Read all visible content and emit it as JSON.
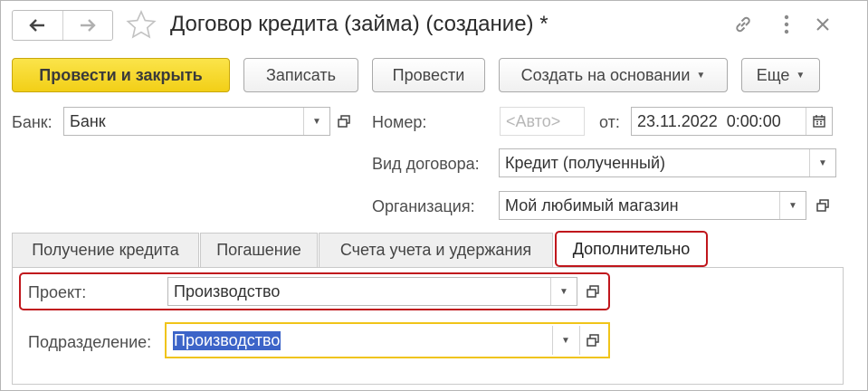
{
  "window": {
    "title": "Договор кредита (займа) (создание) *",
    "icons": [
      "arrow-left-icon",
      "arrow-right-icon",
      "star-icon",
      "link-icon",
      "more-vertical-icon",
      "close-icon"
    ]
  },
  "toolbar": {
    "post_and_close": "Провести и закрыть",
    "save": "Записать",
    "post": "Провести",
    "create_based_on": "Создать на основании",
    "more": "Еще"
  },
  "header_fields": {
    "bank_label": "Банк:",
    "bank_value": "Банк",
    "number_label": "Номер:",
    "number_placeholder": "<Авто>",
    "date_label": "от:",
    "date_value": "23.11.2022  0:00:00",
    "contract_type_label": "Вид договора:",
    "contract_type_value": "Кредит (полученный)",
    "organization_label": "Организация:",
    "organization_value": "Мой любимый магазин"
  },
  "tabs": [
    {
      "label": "Получение кредита",
      "active": false
    },
    {
      "label": "Погашение",
      "active": false
    },
    {
      "label": "Счета учета и удержания",
      "active": false
    },
    {
      "label": "Дополнительно",
      "active": true
    }
  ],
  "additional": {
    "project_label": "Проект:",
    "project_value": "Производство",
    "department_label": "Подразделение:",
    "department_value": "Производство"
  },
  "colors": {
    "primary_button": "#f5d320",
    "highlight_red": "#c0161c",
    "focus_yellow": "#f0c419",
    "selection_blue": "#3c64c8"
  }
}
